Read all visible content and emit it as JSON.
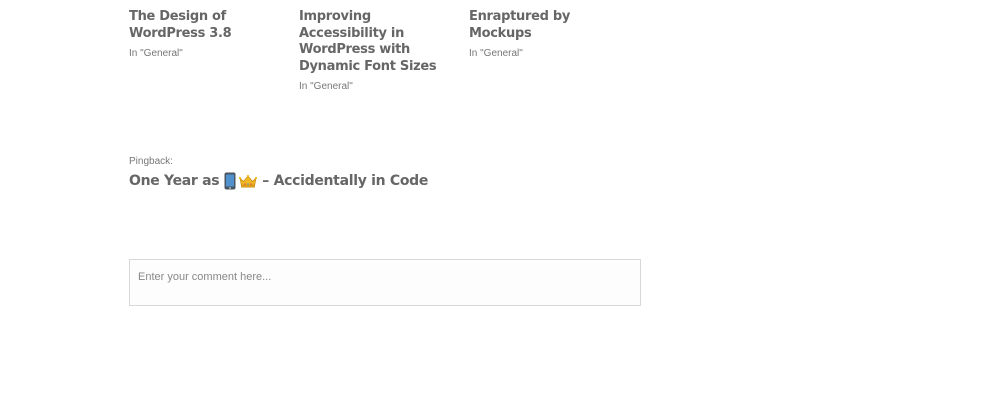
{
  "related_posts": [
    {
      "title": "The Design of WordPress 3.8",
      "category": "In \"General\""
    },
    {
      "title": "Improving Accessibility in WordPress with Dynamic Font Sizes",
      "category": "In \"General\""
    },
    {
      "title": "Enraptured by Mockups",
      "category": "In \"General\""
    }
  ],
  "pingback": {
    "label": "Pingback:",
    "title_prefix": "One Year as",
    "title_suffix": "– Accidentally in Code",
    "icons": [
      "mobile-phone-icon",
      "crown-icon"
    ]
  },
  "comment_form": {
    "placeholder": "Enter your comment here..."
  },
  "colors": {
    "text": "#666666",
    "meta": "#777777",
    "border": "#d8d8d8"
  }
}
